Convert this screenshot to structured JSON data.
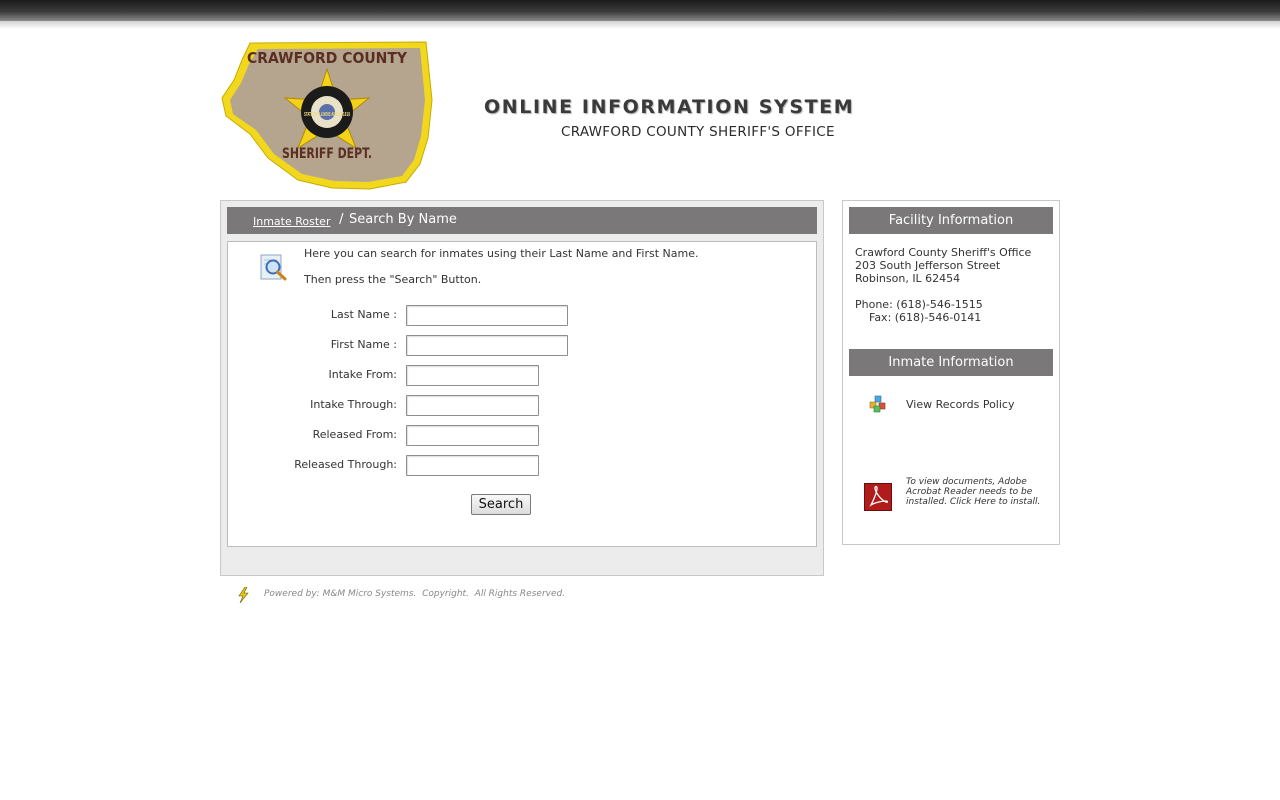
{
  "header": {
    "logo": {
      "icon": "sheriff-badge-logo",
      "text_top": "CRAWFORD COUNTY",
      "text_seal": "STATE OF ILLINOIS AUG 26 1818",
      "text_bottom": "SHERIFF DEPT."
    },
    "title": "ONLINE INFORMATION SYSTEM",
    "subtitle": "CRAWFORD COUNTY SHERIFF'S OFFICE"
  },
  "breadcrumb": {
    "link": "Inmate Roster",
    "separator": " / ",
    "current": "Search By Name"
  },
  "search_form": {
    "intro_line1": "Here you can search for inmates using their Last Name and First Name.",
    "intro_line2": "Then press the \"Search\" Button.",
    "fields": {
      "last_name": {
        "label": "Last Name :",
        "value": ""
      },
      "first_name": {
        "label": "First Name :",
        "value": ""
      },
      "intake_from": {
        "label": "Intake From:",
        "value": ""
      },
      "intake_through": {
        "label": "Intake Through:",
        "value": ""
      },
      "released_from": {
        "label": "Released From:",
        "value": ""
      },
      "released_through": {
        "label": "Released Through:",
        "value": ""
      }
    },
    "search_label": "Search"
  },
  "facility": {
    "title": "Facility Information",
    "name": "Crawford County Sheriff's Office",
    "street": "203 South Jefferson Street",
    "city": "Robinson, IL 62454",
    "phone": "Phone: (618)-546-1515",
    "fax": "Fax: (618)-546-0141"
  },
  "inmate_info": {
    "title": "Inmate Information",
    "records_link": "View Records Policy",
    "acrobat_note": "To view documents, Adobe Acrobat Reader needs to be installed. Click Here to install."
  },
  "footer": {
    "text": "Powered by: M&M Micro Systems.  Copyright.  All Rights Reserved."
  },
  "colors": {
    "header_bar": "#7a7879",
    "panel_bg": "#ececec",
    "badge_yellow": "#f2d81c",
    "badge_tan": "#b5a58f",
    "badge_text": "#5a2e22"
  }
}
